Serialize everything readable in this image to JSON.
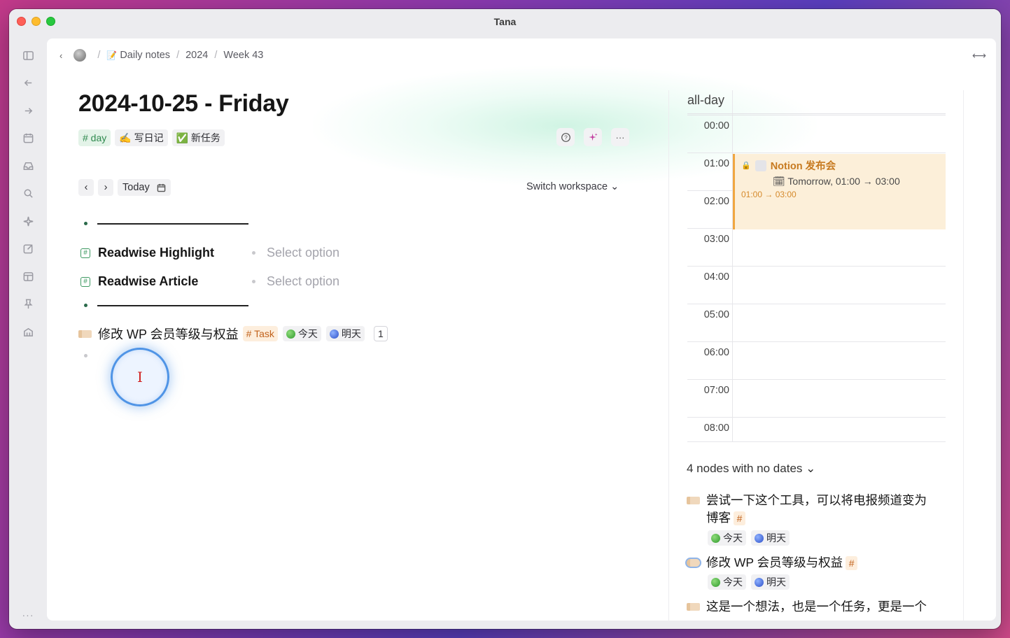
{
  "window": {
    "title": "Tana"
  },
  "breadcrumb": {
    "items": [
      "Daily notes",
      "2024",
      "Week 43"
    ]
  },
  "page": {
    "title": "2024-10-25 - Friday",
    "tags": [
      "# day",
      "✍️ 写日记",
      "✅ 新任务"
    ]
  },
  "title_actions": {
    "more": "···"
  },
  "date_nav": {
    "today_label": "Today",
    "switch_workspace": "Switch workspace ⌄"
  },
  "fields": [
    {
      "name": "Readwise Highlight",
      "value": "Select option"
    },
    {
      "name": "Readwise Article",
      "value": "Select option"
    }
  ],
  "task": {
    "text": "修改 WP 会员等级与权益",
    "tag": "# Task",
    "chip_today": "今天",
    "chip_tomorrow": "明天",
    "count": "1"
  },
  "calendar": {
    "allday_label": "all-day",
    "hours": [
      "00:00",
      "01:00",
      "02:00",
      "03:00",
      "04:00",
      "05:00",
      "06:00",
      "07:00",
      "08:00"
    ],
    "event": {
      "title": "Notion 发布会",
      "date_line": "Tomorrow, 01:00 → 03:00",
      "time_line": "01:00 → 03:00",
      "accent": "#f0a640"
    }
  },
  "no_dates": {
    "label": "4 nodes with no dates ⌄",
    "items": [
      {
        "text": "尝试一下这个工具，可以将电报频道变为博客",
        "tag": "#",
        "chips": [
          "今天",
          "明天"
        ]
      },
      {
        "text": "修改 WP 会员等级与权益",
        "tag": "#",
        "chips": [
          "今天",
          "明天"
        ]
      },
      {
        "text": "这是一个想法，也是一个任务，更是一个"
      }
    ]
  },
  "sidebar": {
    "more": "···"
  }
}
